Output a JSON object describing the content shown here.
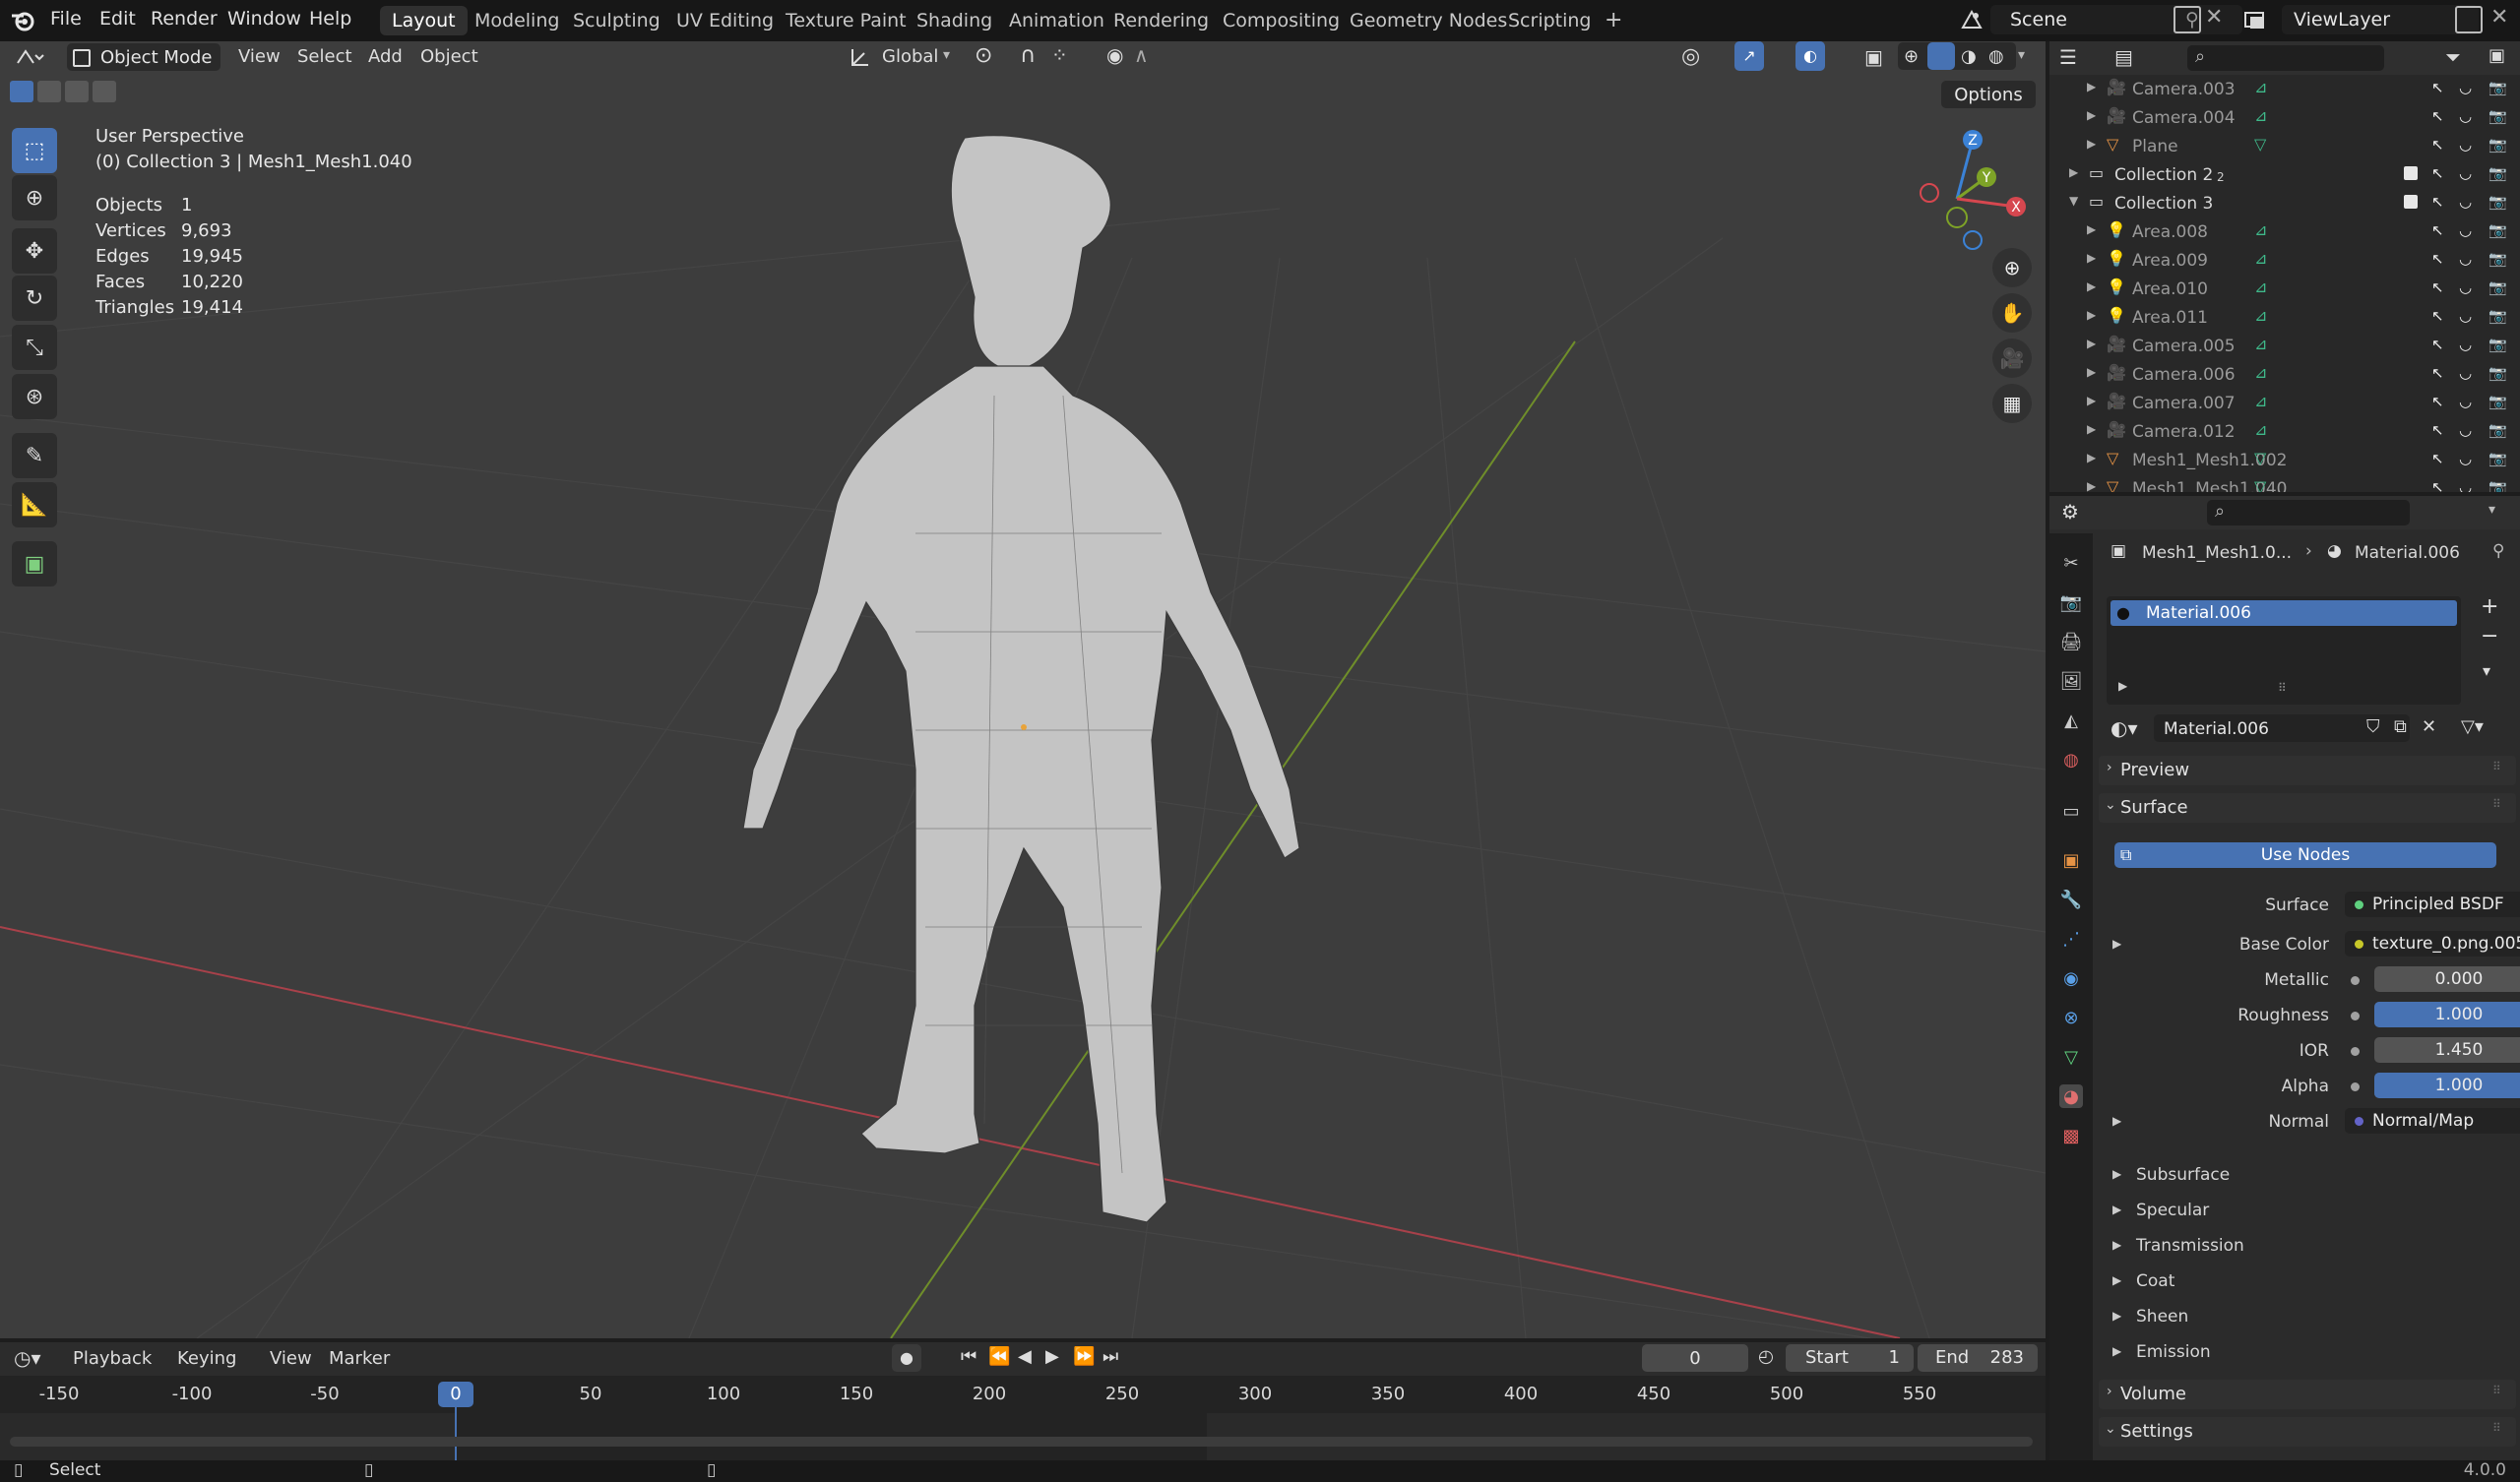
{
  "topbar": {
    "menus": [
      "File",
      "Edit",
      "Render",
      "Window",
      "Help"
    ],
    "workspaces": [
      "Layout",
      "Modeling",
      "Sculpting",
      "UV Editing",
      "Texture Paint",
      "Shading",
      "Animation",
      "Rendering",
      "Compositing",
      "Geometry Nodes",
      "Scripting"
    ],
    "active_workspace": "Layout",
    "add_tab": "+",
    "scene_name": "Scene",
    "view_layer": "ViewLayer"
  },
  "viewport_header": {
    "mode": "Object Mode",
    "menus": [
      "View",
      "Select",
      "Add",
      "Object"
    ],
    "transform_orientation": "Global",
    "options_label": "Options"
  },
  "overlay_info": {
    "view_name": "User Perspective",
    "collection_info": "(0) Collection 3 | Mesh1_Mesh1.040",
    "stats": [
      {
        "label": "Objects",
        "value": "1"
      },
      {
        "label": "Vertices",
        "value": "9,693"
      },
      {
        "label": "Edges",
        "value": "19,945"
      },
      {
        "label": "Faces",
        "value": "10,220"
      },
      {
        "label": "Triangles",
        "value": "19,414"
      }
    ]
  },
  "gizmo": {
    "x": "X",
    "y": "Y",
    "z": "Z"
  },
  "outliner": {
    "rows": [
      {
        "name": "Camera.003",
        "kind": "camera",
        "indent": 2,
        "dim": true
      },
      {
        "name": "Camera.004",
        "kind": "camera",
        "indent": 2,
        "dim": true
      },
      {
        "name": "Plane",
        "kind": "mesh",
        "indent": 2,
        "dim": true
      },
      {
        "name": "Collection 2",
        "kind": "collection",
        "indent": 1,
        "dim": false,
        "badge": "2"
      },
      {
        "name": "Collection 3",
        "kind": "collection",
        "indent": 1,
        "dim": false,
        "expanded": true
      },
      {
        "name": "Area.008",
        "kind": "light",
        "indent": 2,
        "dim": true
      },
      {
        "name": "Area.009",
        "kind": "light",
        "indent": 2,
        "dim": true
      },
      {
        "name": "Area.010",
        "kind": "light",
        "indent": 2,
        "dim": true
      },
      {
        "name": "Area.011",
        "kind": "light",
        "indent": 2,
        "dim": true
      },
      {
        "name": "Camera.005",
        "kind": "camera",
        "indent": 2,
        "dim": true
      },
      {
        "name": "Camera.006",
        "kind": "camera",
        "indent": 2,
        "dim": true
      },
      {
        "name": "Camera.007",
        "kind": "camera",
        "indent": 2,
        "dim": true
      },
      {
        "name": "Camera.012",
        "kind": "camera",
        "indent": 2,
        "dim": true
      },
      {
        "name": "Mesh1_Mesh1.002",
        "kind": "mesh",
        "indent": 2,
        "dim": true
      },
      {
        "name": "Mesh1_Mesh1.040",
        "kind": "mesh",
        "indent": 2,
        "dim": true
      }
    ]
  },
  "properties": {
    "breadcrumb_object": "Mesh1_Mesh1.0...",
    "breadcrumb_material": "Material.006",
    "slot_name": "Material.006",
    "material_name": "Material.006",
    "panel_preview": "Preview",
    "panel_surface": "Surface",
    "use_nodes_label": "Use Nodes",
    "surface_label": "Surface",
    "surface_value": "Principled BSDF",
    "inputs": [
      {
        "label": "Base Color",
        "value": "texture_0.png.005",
        "type": "link",
        "socket": "#c7c729",
        "expand": true
      },
      {
        "label": "Metallic",
        "value": "0.000",
        "type": "slider",
        "fill": 0.0,
        "socket": "#a1a1a1"
      },
      {
        "label": "Roughness",
        "value": "1.000",
        "type": "slider",
        "fill": 1.0,
        "socket": "#a1a1a1"
      },
      {
        "label": "IOR",
        "value": "1.450",
        "type": "slider",
        "fill": 0.0,
        "socket": "#a1a1a1"
      },
      {
        "label": "Alpha",
        "value": "1.000",
        "type": "slider",
        "fill": 1.0,
        "socket": "#a1a1a1"
      },
      {
        "label": "Normal",
        "value": "Normal/Map",
        "type": "link",
        "socket": "#6363c7",
        "expand": true
      }
    ],
    "subpanels": [
      "Subsurface",
      "Specular",
      "Transmission",
      "Coat",
      "Sheen",
      "Emission"
    ],
    "panel_volume": "Volume",
    "panel_settings": "Settings"
  },
  "timeline": {
    "menus": [
      "Playback",
      "Keying",
      "View",
      "Marker"
    ],
    "current_frame": "0",
    "start_label": "Start",
    "start_value": "1",
    "end_label": "End",
    "end_value": "283",
    "ticks": [
      "-150",
      "-100",
      "-50",
      "0",
      "50",
      "100",
      "150",
      "200",
      "250",
      "300",
      "350",
      "400",
      "450",
      "500",
      "550"
    ]
  },
  "statusbar": {
    "left": "Select",
    "version": "4.0.0"
  },
  "colors": {
    "accent": "#4772b3",
    "x_axis": "#d6474f",
    "y_axis": "#7ea327",
    "z_axis": "#3b82d6"
  }
}
